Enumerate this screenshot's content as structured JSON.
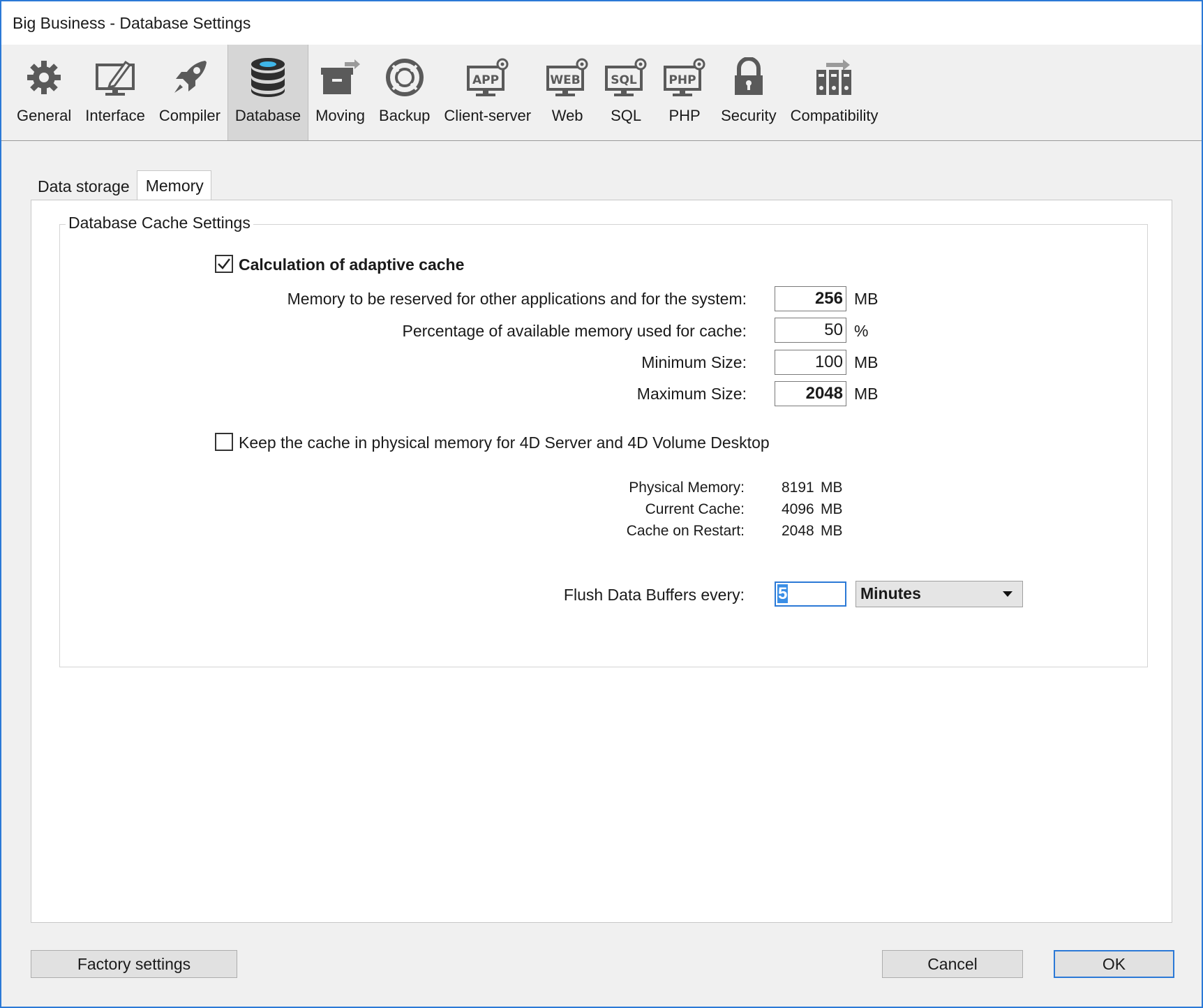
{
  "window": {
    "title": "Big Business - Database Settings"
  },
  "toolbar": {
    "items": [
      {
        "label": "General",
        "icon": "gear-icon"
      },
      {
        "label": "Interface",
        "icon": "monitor-pen-icon"
      },
      {
        "label": "Compiler",
        "icon": "rocket-icon"
      },
      {
        "label": "Database",
        "icon": "database-icon"
      },
      {
        "label": "Moving",
        "icon": "box-arrow-icon"
      },
      {
        "label": "Backup",
        "icon": "lifebuoy-icon"
      },
      {
        "label": "Client-server",
        "icon": "app-server-icon"
      },
      {
        "label": "Web",
        "icon": "web-server-icon"
      },
      {
        "label": "SQL",
        "icon": "sql-server-icon"
      },
      {
        "label": "PHP",
        "icon": "php-server-icon"
      },
      {
        "label": "Security",
        "icon": "padlock-icon"
      },
      {
        "label": "Compatibility",
        "icon": "compatibility-icon"
      }
    ],
    "selected": "Database"
  },
  "tabs": [
    {
      "label": "Data storage",
      "active": false
    },
    {
      "label": "Memory",
      "active": true
    }
  ],
  "group": {
    "title": "Database Cache Settings",
    "adaptive_cache": {
      "label": "Calculation of adaptive cache",
      "checked": true
    },
    "reserved": {
      "label": "Memory to be reserved for other applications and for the system:",
      "value": "256",
      "unit": "MB"
    },
    "percentage": {
      "label": "Percentage of available memory used for cache:",
      "value": "50",
      "unit": "%"
    },
    "minimum": {
      "label": "Minimum Size:",
      "value": "100",
      "unit": "MB"
    },
    "maximum": {
      "label": "Maximum Size:",
      "value": "2048",
      "unit": "MB"
    },
    "keep_physical": {
      "label": "Keep the cache in physical memory for 4D Server and 4D Volume Desktop",
      "checked": false
    },
    "info": {
      "physical": {
        "label": "Physical Memory:",
        "value": "8191",
        "unit": "MB"
      },
      "current": {
        "label": "Current Cache:",
        "value": "4096",
        "unit": "MB"
      },
      "restart": {
        "label": "Cache on Restart:",
        "value": "2048",
        "unit": "MB"
      }
    },
    "flush": {
      "label": "Flush Data Buffers every:",
      "value": "5",
      "unit_selected": "Minutes"
    }
  },
  "buttons": {
    "factory": "Factory settings",
    "cancel": "Cancel",
    "ok": "OK"
  },
  "colors": {
    "accent": "#2b79d6",
    "selection": "#3a8ee6",
    "db_accent": "#3fb6e8"
  }
}
